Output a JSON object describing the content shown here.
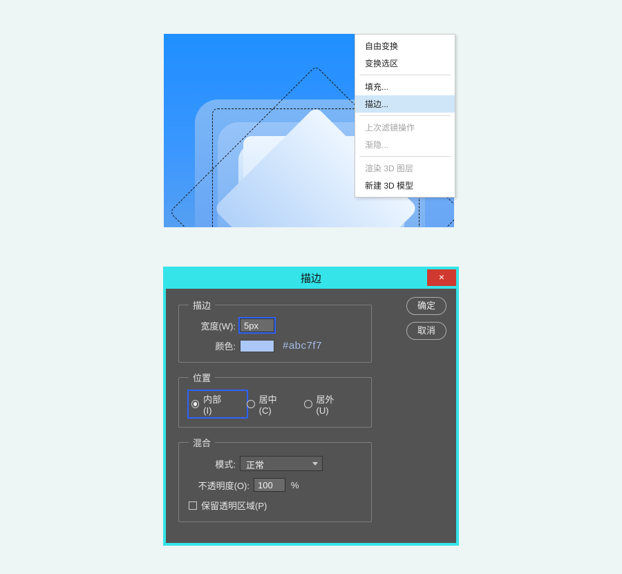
{
  "contextMenu": {
    "items": [
      {
        "label": "自由变换",
        "disabled": false
      },
      {
        "label": "变换选区",
        "disabled": false
      },
      {
        "sep": true
      },
      {
        "label": "填充...",
        "disabled": false
      },
      {
        "label": "描边...",
        "disabled": false,
        "highlight": true
      },
      {
        "sep": true
      },
      {
        "label": "上次滤镜操作",
        "disabled": true
      },
      {
        "label": "渐隐...",
        "disabled": true
      },
      {
        "sep": true
      },
      {
        "label": "渲染 3D 图层",
        "disabled": true
      },
      {
        "label": "新建 3D 模型",
        "disabled": false
      }
    ]
  },
  "dialog": {
    "title": "描边",
    "closeGlyph": "×",
    "okLabel": "确定",
    "cancelLabel": "取消",
    "sections": {
      "stroke": {
        "legend": "描边",
        "widthLabel": "宽度(W):",
        "widthValue": "5px",
        "colorLabel": "颜色:",
        "colorHex": "#abc7f7"
      },
      "position": {
        "legend": "位置",
        "options": [
          {
            "label": "内部(I)",
            "checked": true
          },
          {
            "label": "居中(C)",
            "checked": false
          },
          {
            "label": "居外(U)",
            "checked": false
          }
        ]
      },
      "blend": {
        "legend": "混合",
        "modeLabel": "模式:",
        "modeValue": "正常",
        "opacityLabel": "不透明度(O):",
        "opacityValue": "100",
        "opacitySuffix": "%",
        "preserveLabel": "保留透明区域(P)"
      }
    }
  }
}
